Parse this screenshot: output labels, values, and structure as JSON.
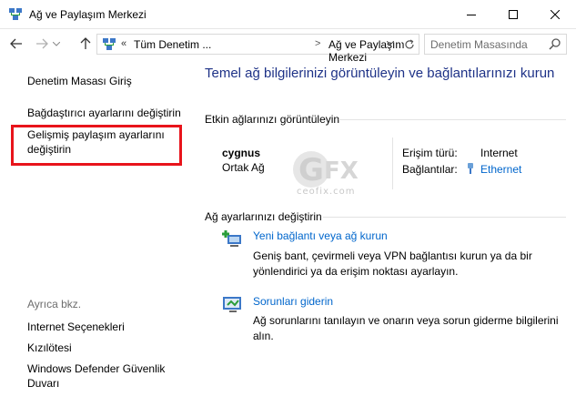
{
  "window": {
    "title": "Ağ ve Paylaşım Merkezi"
  },
  "navigation": {
    "breadcrumb_overflow": "«",
    "breadcrumb": [
      "Tüm Denetim ...",
      "Ağ ve Paylaşım Merkezi"
    ],
    "breadcrumb_separator": ">",
    "search_placeholder": "Denetim Masasında"
  },
  "sidebar": {
    "links": [
      "Denetim Masası Giriş",
      "Bağdaştırıcı ayarlarını değiştirin",
      "Gelişmiş paylaşım ayarlarını değiştirin"
    ],
    "see_also_label": "Ayrıca bkz.",
    "see_also_links": [
      "Internet Seçenekleri",
      "Kızılötesi",
      "Windows Defender Güvenlik Duvarı"
    ],
    "highlight_color": "#e8141b"
  },
  "main": {
    "heading": "Temel ağ bilgilerinizi görüntüleyin ve bağlantılarınızı kurun",
    "active_networks_title": "Etkin ağlarınızı görüntüleyin",
    "network": {
      "name": "cygnus",
      "category": "Ortak Ağ",
      "access_type_label": "Erişim türü:",
      "access_type_value": "Internet",
      "connections_label": "Bağlantılar:",
      "connection_name": "Ethernet"
    },
    "change_settings_title": "Ağ ayarlarınızı değiştirin",
    "tasks": [
      {
        "link": "Yeni bağlantı veya ağ kurun",
        "description": "Geniş bant, çevirmeli veya VPN bağlantısı kurun ya da bir yönlendirici ya da erişim noktası ayarlayın.",
        "icon": "new-connection-icon"
      },
      {
        "link": "Sorunları giderin",
        "description": "Ağ sorunlarını tanılayın ve onarın veya sorun giderme bilgilerini alın.",
        "icon": "troubleshoot-icon"
      }
    ]
  },
  "watermark": {
    "logo_text": "GFX",
    "site": "ceofix.com"
  },
  "colors": {
    "heading": "#1e3287",
    "link": "#0066cc",
    "muted": "#6d6d6d"
  }
}
